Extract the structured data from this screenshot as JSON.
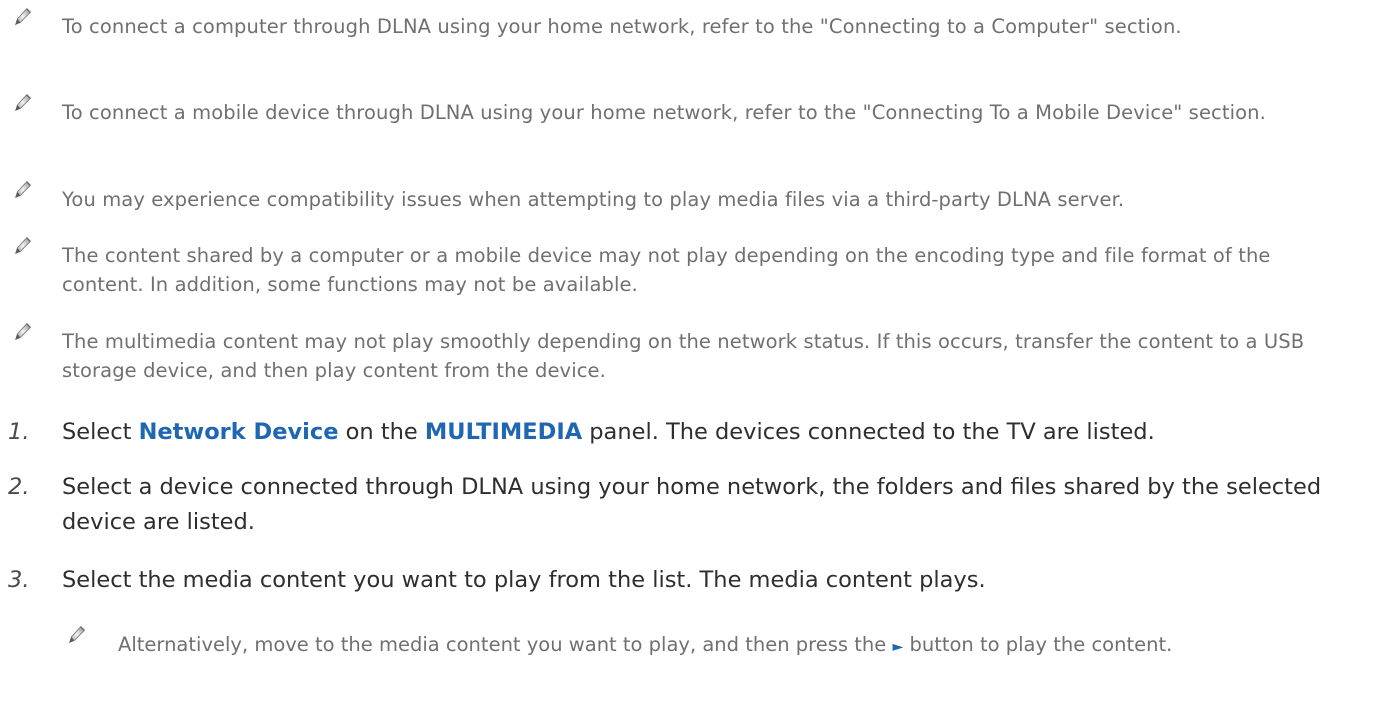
{
  "notes": [
    "To connect a computer through DLNA using your home network, refer to the \"Connecting to a Computer\" section.",
    "To connect a mobile device through DLNA using your home network, refer to the \"Connecting To a Mobile Device\" section.",
    "You may experience compatibility issues when attempting to play media files via a third-party DLNA server.",
    "The content shared by a computer or a mobile device may not play depending on the encoding type and file format of the content. In addition, some functions may not be available.",
    "The multimedia content may not play smoothly depending on the network status. If this occurs, transfer the content to a USB storage device, and then play content from the device."
  ],
  "steps": {
    "s1": {
      "num": "1.",
      "pre": "Select ",
      "kw1": "Network Device",
      "mid": " on the ",
      "kw2": "MULTIMEDIA",
      "post": " panel. The devices connected to the TV are listed."
    },
    "s2": {
      "num": "2.",
      "text": "Select a device connected through DLNA using your home network, the folders and files shared by the selected device are listed."
    },
    "s3": {
      "num": "3.",
      "text": "Select the media content you want to play from the list. The media content plays."
    }
  },
  "subnote": {
    "pre": "Alternatively, move to the media content you want to play, and then press the ",
    "button_glyph": "►",
    "post": " button to play the content."
  },
  "colors": {
    "keyword": "#1f66b3",
    "note_text": "#707070",
    "step_text": "#2e2e2e"
  },
  "icons": {
    "note_marker": "pencil-icon"
  }
}
